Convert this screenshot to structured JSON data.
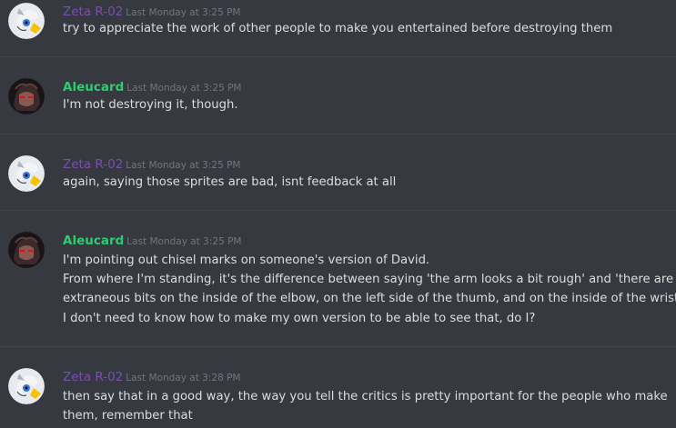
{
  "messages": [
    {
      "author": "Zeta R-02",
      "timestamp": "Last Monday at 3:25 PM",
      "lines": [
        "try to appreciate the work of other people to make you entertained before destroying them"
      ],
      "avatar_icon": "zeta-avatar"
    },
    {
      "author": "Aleucard",
      "timestamp": "Last Monday at 3:25 PM",
      "lines": [
        "I'm not destroying it, though."
      ],
      "avatar_icon": "aleucard-avatar"
    },
    {
      "author": "Zeta R-02",
      "timestamp": "Last Monday at 3:25 PM",
      "lines": [
        "again, saying those sprites are bad, isnt feedback at all"
      ],
      "avatar_icon": "zeta-avatar"
    },
    {
      "author": "Aleucard",
      "timestamp": "Last Monday at 3:25 PM",
      "lines": [
        "I'm pointing out chisel marks on someone's version of David.",
        "From where I'm standing, it's the difference between saying 'the arm looks a bit rough' and 'there are",
        "extraneous bits on the inside of the elbow, on the left side of the thumb, and on the inside of the wrist'",
        "I don't need to know how to make my own version to be able to see that, do I?"
      ],
      "avatar_icon": "aleucard-avatar"
    },
    {
      "author": "Zeta R-02",
      "timestamp": "Last Monday at 3:28 PM",
      "lines": [
        "then say that in a good way, the way you tell the critics is pretty important for the people who make",
        "them, remember that"
      ],
      "avatar_icon": "zeta-avatar"
    }
  ],
  "colors": {
    "background": "#36393f",
    "zeta_name": "#7a4fae",
    "aleucard_name": "#2ecc71",
    "text": "#dcddde",
    "timestamp": "#72767d"
  }
}
